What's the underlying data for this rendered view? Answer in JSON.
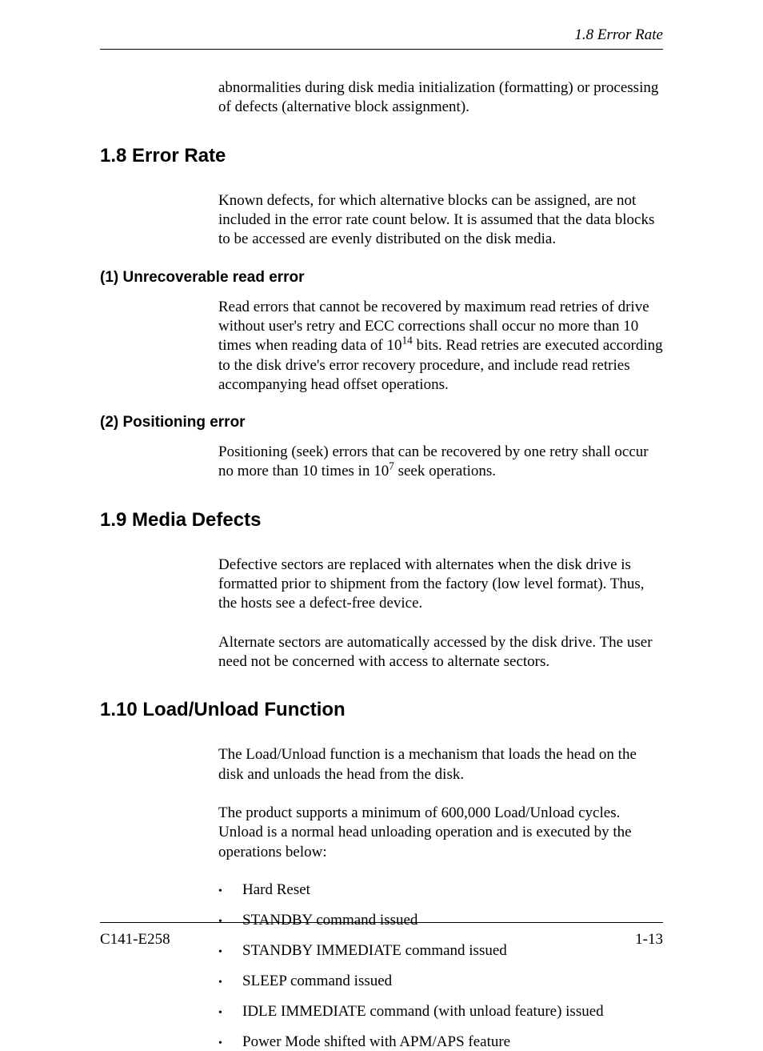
{
  "header": {
    "running_title": "1.8  Error Rate"
  },
  "intro_paragraph": "abnormalities during disk media initialization (formatting) or processing of defects (alternative block assignment).",
  "section_1_8": {
    "heading": "1.8  Error Rate",
    "intro": "Known defects, for which alternative blocks can be assigned, are not included in the error rate count below.  It is assumed that the data blocks to be accessed are evenly distributed on the disk media.",
    "sub1": {
      "heading": "(1)  Unrecoverable read error",
      "text_pre": "Read errors that cannot be recovered by maximum read retries of drive without user's retry and ECC corrections shall occur no more than 10 times when reading data of 10",
      "exp": "14",
      "text_post": " bits. Read retries are executed according to the disk drive's error recovery procedure, and include read retries accompanying head offset operations."
    },
    "sub2": {
      "heading": "(2)  Positioning error",
      "text_pre": "Positioning (seek) errors that can be recovered by one retry shall occur no more than 10 times in 10",
      "exp": "7",
      "text_post": " seek operations."
    }
  },
  "section_1_9": {
    "heading": "1.9  Media Defects",
    "para1": "Defective sectors are replaced with alternates when the disk drive is formatted prior to shipment from the factory (low level format).  Thus, the hosts see a defect-free device.",
    "para2": "Alternate sectors are automatically accessed by the disk drive.  The user need not be concerned with access to alternate sectors."
  },
  "section_1_10": {
    "heading": "1.10  Load/Unload Function",
    "para1": "The Load/Unload function is a mechanism that loads the head on the disk and unloads the head from the disk.",
    "para2a": "The product supports a minimum of 600,000 Load/Unload cycles.",
    "para2b": "Unload is a normal head unloading operation and is executed by the operations below:",
    "bullets": [
      "Hard Reset",
      "STANDBY command issued",
      "STANDBY IMMEDIATE command issued",
      "SLEEP command issued",
      "IDLE IMMEDIATE command (with unload feature) issued",
      "Power Mode shifted with APM/APS feature"
    ]
  },
  "footer": {
    "left": "C141-E258",
    "right": "1-13"
  }
}
